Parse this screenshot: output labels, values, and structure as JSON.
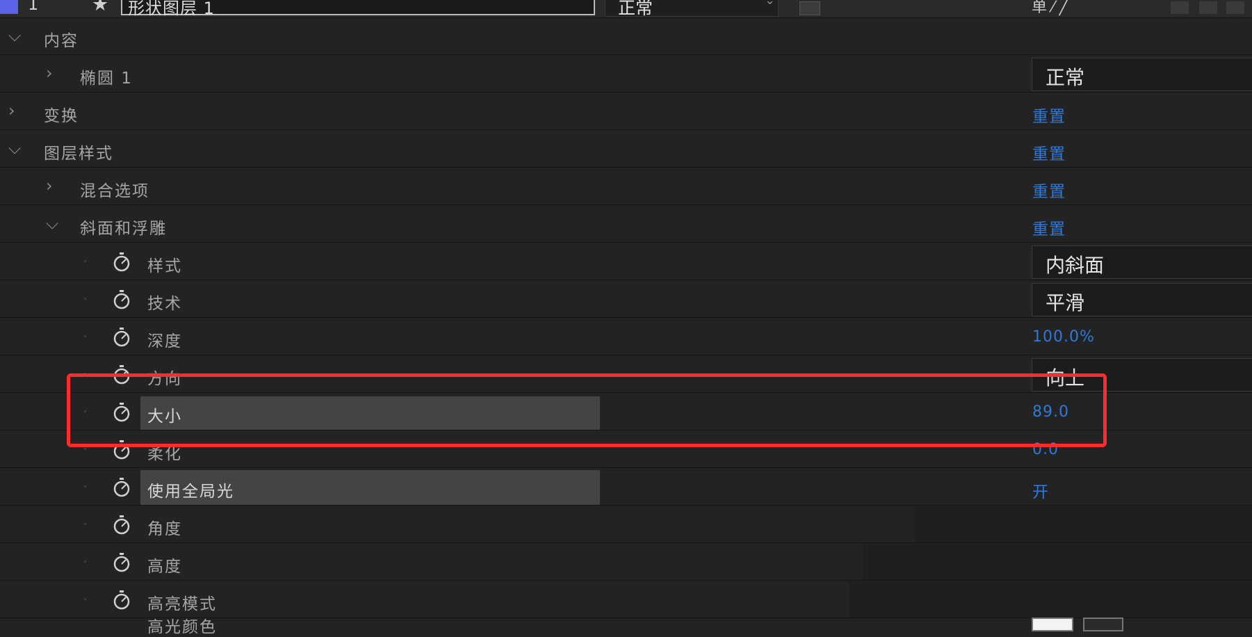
{
  "header": {
    "layer_number": "1",
    "star": "★",
    "layer_name": "形状图层 1",
    "blend_mode": "正常",
    "switch_glyphs": "单 ⁄ ╱",
    "color_label": "#5b63e6"
  },
  "rows": [
    {
      "label": "内容",
      "expanded": true
    },
    {
      "label": "椭圆 1",
      "expanded": false,
      "value_type": "dropdown",
      "value": "正常"
    },
    {
      "label": "变换",
      "expanded": false,
      "value_type": "link",
      "value": "重置"
    },
    {
      "label": "图层样式",
      "expanded": true,
      "value_type": "link",
      "value": "重置"
    },
    {
      "label": "混合选项",
      "expanded": false,
      "value_type": "link",
      "value": "重置"
    },
    {
      "label": "斜面和浮雕",
      "expanded": true,
      "value_type": "link",
      "value": "重置"
    },
    {
      "label": "样式",
      "value_type": "dropdown",
      "value": "内斜面"
    },
    {
      "label": "技术",
      "value_type": "dropdown",
      "value": "平滑"
    },
    {
      "label": "深度",
      "value_type": "number",
      "value": "100.0%"
    },
    {
      "label": "方向",
      "value_type": "dropdown",
      "value": "向上"
    },
    {
      "label": "大小",
      "value_type": "number",
      "value": "89.0",
      "selected": true
    },
    {
      "label": "柔化",
      "value_type": "number",
      "value": "0.0"
    },
    {
      "label": "使用全局光",
      "value_type": "link",
      "value": "开",
      "selected": true
    },
    {
      "label": "角度"
    },
    {
      "label": "高度"
    },
    {
      "label": "高亮模式"
    },
    {
      "label": "高光颜色"
    }
  ],
  "icons": {
    "chevron_down": "⌵",
    "chevron_right": "›",
    "stopwatch": "stopwatch-icon"
  },
  "colors": {
    "link_blue": "#2e79d9",
    "annotation_red": "#ff2a2a",
    "selection_gray": "#444444"
  }
}
